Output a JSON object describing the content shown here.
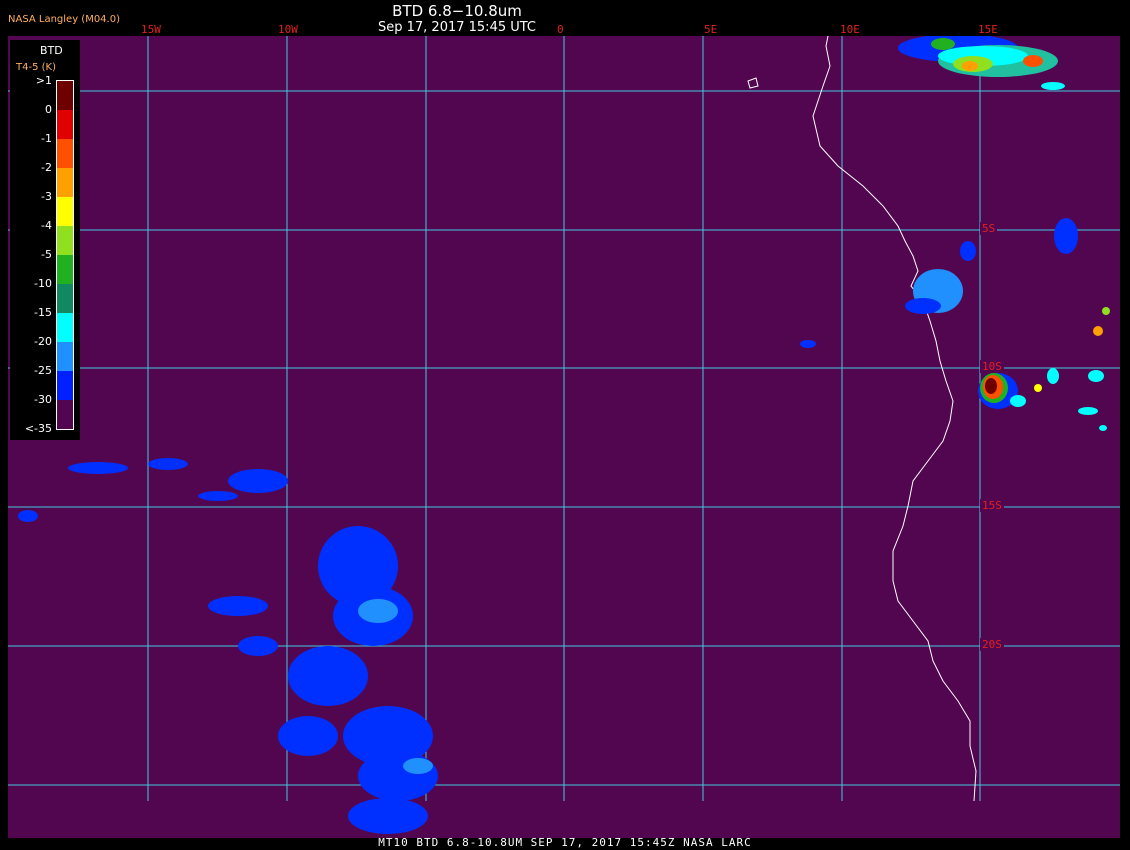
{
  "header": {
    "title": "BTD 6.8−10.8um",
    "datetime": "Sep 17, 2017 15:45 UTC",
    "credit": "NASA Langley (M04.0)"
  },
  "footer": {
    "text": "MT10  BTD 6.8-10.8UM  SEP 17, 2017 15:45Z  NASA LARC"
  },
  "lon_labels": [
    "15W",
    "10W",
    "0",
    "5E",
    "10E",
    "15E"
  ],
  "lat_labels": [
    "5S",
    "10S",
    "15S",
    "20S"
  ],
  "legend": {
    "title": "BTD",
    "subtitle": "T4-5 (K)",
    "labels": [
      ">1",
      "0",
      "-1",
      "-2",
      "-3",
      "-4",
      "-5",
      "-10",
      "-15",
      "-20",
      "-25",
      "-30",
      "<-35"
    ],
    "colors": [
      "#6e0000",
      "#e00000",
      "#ff5000",
      "#ffa000",
      "#ffff00",
      "#90e020",
      "#20b020",
      "#108860",
      "#00ffff",
      "#2090ff",
      "#0020ff",
      "#530650"
    ]
  },
  "colors": {
    "background": "#530650",
    "grid": "#40c8e0",
    "coast": "#ffffff"
  }
}
